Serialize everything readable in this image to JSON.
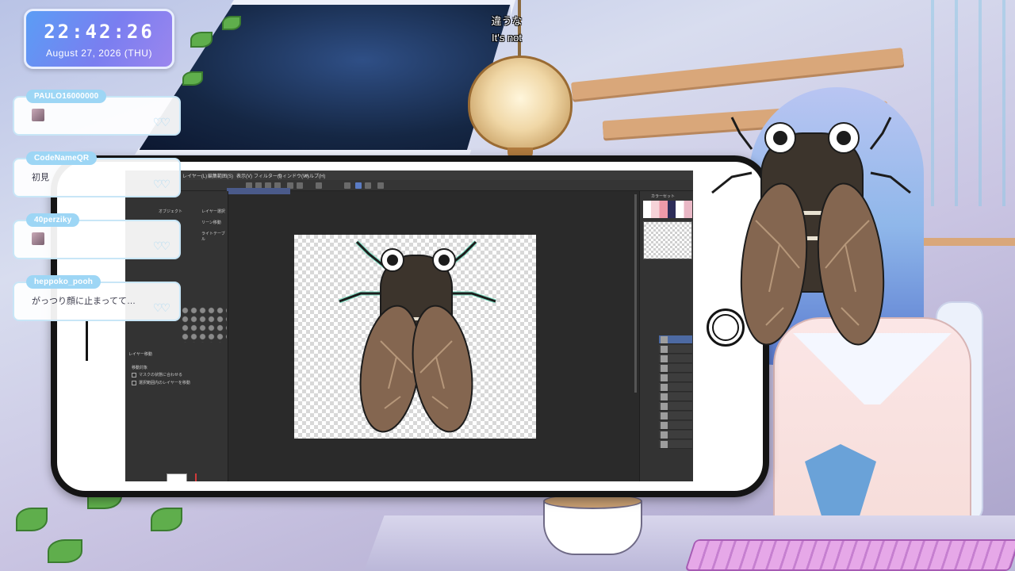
{
  "clock": {
    "time": "22:42:26",
    "date": "August 27, 2026 (THU)"
  },
  "subtitle": {
    "line1": "違うな",
    "line2": "It's not"
  },
  "chat": [
    {
      "user": "PAULO16000000",
      "text": "",
      "has_emoji": true
    },
    {
      "user": "CodeNameQR",
      "text": "初見",
      "has_emoji": false
    },
    {
      "user": "40perziky",
      "text": "",
      "has_emoji": true
    },
    {
      "user": "heppoko_pooh",
      "text": "がっつり顔に止まってて…",
      "has_emoji": false
    }
  ],
  "app": {
    "menu": [
      "レイヤー(L)",
      "編集範囲(S)",
      "表示(V)",
      "フィルター(I)",
      "ウィンドウ(W)",
      "ヘルプ(H)"
    ],
    "left_panel": {
      "labels": [
        "オブジェクト",
        "レイヤー選択",
        "リーン移動",
        "ライトテーブル"
      ],
      "subtool_title": "レイヤー移動",
      "move_target": "移動対象",
      "options": [
        "マスクの状態に合わせる",
        "選択範囲内のレイヤーを移動"
      ]
    },
    "right_panel": {
      "color_set_title": "カラーセット"
    },
    "layer_count": 12
  },
  "icons": {
    "home_button": "home-button-icon",
    "hearts": "hearts-icon"
  },
  "colors": {
    "clock_gradient_start": "#5b9df5",
    "clock_gradient_end": "#9b86ee",
    "chat_username_bg": "#9dd6f5",
    "cicada_body": "#3c342c",
    "cicada_wing": "#846650",
    "cicada_accent": "#7ee0c4",
    "phone_border": "#141414"
  }
}
